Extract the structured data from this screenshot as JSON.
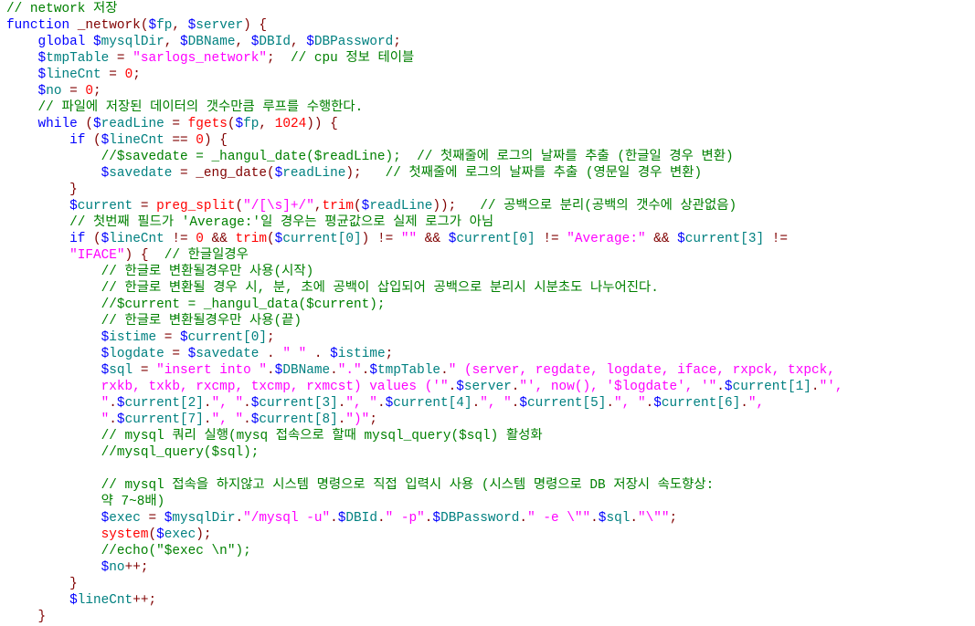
{
  "editor": {
    "language": "php",
    "colors": {
      "keyword": "#0000ff",
      "variable_sigil": "#0000ff",
      "variable_name": "#008080",
      "string": "#ff00ff",
      "comment": "#008000",
      "function": "#ff0000",
      "number": "#ff0000",
      "operator": "#800000",
      "background": "#ffffff"
    },
    "lines": [
      [
        {
          "t": "cm",
          "v": "// network 저장"
        }
      ],
      [
        {
          "t": "kw",
          "v": "function"
        },
        {
          "t": "op",
          "v": " _network("
        },
        {
          "t": "dl",
          "v": "$"
        },
        {
          "t": "vn",
          "v": "fp"
        },
        {
          "t": "op",
          "v": ", "
        },
        {
          "t": "dl",
          "v": "$"
        },
        {
          "t": "vn",
          "v": "server"
        },
        {
          "t": "op",
          "v": ") {"
        }
      ],
      [
        {
          "t": "op",
          "v": "    "
        },
        {
          "t": "kw",
          "v": "global"
        },
        {
          "t": "op",
          "v": " "
        },
        {
          "t": "dl",
          "v": "$"
        },
        {
          "t": "vn",
          "v": "mysqlDir"
        },
        {
          "t": "op",
          "v": ", "
        },
        {
          "t": "dl",
          "v": "$"
        },
        {
          "t": "vn",
          "v": "DBName"
        },
        {
          "t": "op",
          "v": ", "
        },
        {
          "t": "dl",
          "v": "$"
        },
        {
          "t": "vn",
          "v": "DBId"
        },
        {
          "t": "op",
          "v": ", "
        },
        {
          "t": "dl",
          "v": "$"
        },
        {
          "t": "vn",
          "v": "DBPassword"
        },
        {
          "t": "op",
          "v": ";"
        }
      ],
      [
        {
          "t": "op",
          "v": "    "
        },
        {
          "t": "dl",
          "v": "$"
        },
        {
          "t": "vn",
          "v": "tmpTable"
        },
        {
          "t": "op",
          "v": " = "
        },
        {
          "t": "st",
          "v": "\"sarlogs_network\""
        },
        {
          "t": "op",
          "v": ";  "
        },
        {
          "t": "cm",
          "v": "// cpu 정보 테이블"
        }
      ],
      [
        {
          "t": "op",
          "v": "    "
        },
        {
          "t": "dl",
          "v": "$"
        },
        {
          "t": "vn",
          "v": "lineCnt"
        },
        {
          "t": "op",
          "v": " = "
        },
        {
          "t": "nm",
          "v": "0"
        },
        {
          "t": "op",
          "v": ";"
        }
      ],
      [
        {
          "t": "op",
          "v": "    "
        },
        {
          "t": "dl",
          "v": "$"
        },
        {
          "t": "vn",
          "v": "no"
        },
        {
          "t": "op",
          "v": " = "
        },
        {
          "t": "nm",
          "v": "0"
        },
        {
          "t": "op",
          "v": ";"
        }
      ],
      [
        {
          "t": "op",
          "v": "    "
        },
        {
          "t": "cm",
          "v": "// 파일에 저장된 데이터의 갯수만큼 루프를 수행한다."
        }
      ],
      [
        {
          "t": "op",
          "v": "    "
        },
        {
          "t": "kw",
          "v": "while"
        },
        {
          "t": "op",
          "v": " ("
        },
        {
          "t": "dl",
          "v": "$"
        },
        {
          "t": "vn",
          "v": "readLine"
        },
        {
          "t": "op",
          "v": " = "
        },
        {
          "t": "fn",
          "v": "fgets"
        },
        {
          "t": "op",
          "v": "("
        },
        {
          "t": "dl",
          "v": "$"
        },
        {
          "t": "vn",
          "v": "fp"
        },
        {
          "t": "op",
          "v": ", "
        },
        {
          "t": "nm",
          "v": "1024"
        },
        {
          "t": "op",
          "v": ")) {"
        }
      ],
      [
        {
          "t": "op",
          "v": "        "
        },
        {
          "t": "kw",
          "v": "if"
        },
        {
          "t": "op",
          "v": " ("
        },
        {
          "t": "dl",
          "v": "$"
        },
        {
          "t": "vn",
          "v": "lineCnt"
        },
        {
          "t": "op",
          "v": " == "
        },
        {
          "t": "nm",
          "v": "0"
        },
        {
          "t": "op",
          "v": ") {"
        }
      ],
      [
        {
          "t": "op",
          "v": "            "
        },
        {
          "t": "cm",
          "v": "//$savedate = _hangul_date($readLine);  // 첫째줄에 로그의 날짜를 추출 (한글일 경우 변환)"
        }
      ],
      [
        {
          "t": "op",
          "v": "            "
        },
        {
          "t": "dl",
          "v": "$"
        },
        {
          "t": "vn",
          "v": "savedate"
        },
        {
          "t": "op",
          "v": " = _eng_date("
        },
        {
          "t": "dl",
          "v": "$"
        },
        {
          "t": "vn",
          "v": "readLine"
        },
        {
          "t": "op",
          "v": ");   "
        },
        {
          "t": "cm",
          "v": "// 첫째줄에 로그의 날짜를 추출 (영문일 경우 변환)"
        }
      ],
      [
        {
          "t": "op",
          "v": "        }"
        }
      ],
      [
        {
          "t": "op",
          "v": "        "
        },
        {
          "t": "dl",
          "v": "$"
        },
        {
          "t": "vn",
          "v": "current"
        },
        {
          "t": "op",
          "v": " = "
        },
        {
          "t": "fn",
          "v": "preg_split"
        },
        {
          "t": "op",
          "v": "("
        },
        {
          "t": "st",
          "v": "\"/[\\s]+/\""
        },
        {
          "t": "op",
          "v": ","
        },
        {
          "t": "fn",
          "v": "trim"
        },
        {
          "t": "op",
          "v": "("
        },
        {
          "t": "dl",
          "v": "$"
        },
        {
          "t": "vn",
          "v": "readLine"
        },
        {
          "t": "op",
          "v": "));   "
        },
        {
          "t": "cm",
          "v": "// 공백으로 분리(공백의 갯수에 상관없음)"
        }
      ],
      [
        {
          "t": "op",
          "v": "        "
        },
        {
          "t": "cm",
          "v": "// 첫번째 필드가 'Average:'일 경우는 평균값으로 실제 로그가 아님"
        }
      ],
      [
        {
          "t": "op",
          "v": "        "
        },
        {
          "t": "kw",
          "v": "if"
        },
        {
          "t": "op",
          "v": " ("
        },
        {
          "t": "dl",
          "v": "$"
        },
        {
          "t": "vn",
          "v": "lineCnt"
        },
        {
          "t": "op",
          "v": " != "
        },
        {
          "t": "nm",
          "v": "0"
        },
        {
          "t": "op",
          "v": " && "
        },
        {
          "t": "fn",
          "v": "trim"
        },
        {
          "t": "op",
          "v": "("
        },
        {
          "t": "dl",
          "v": "$"
        },
        {
          "t": "vn",
          "v": "current[0]"
        },
        {
          "t": "op",
          "v": ") != "
        },
        {
          "t": "st",
          "v": "\"\""
        },
        {
          "t": "op",
          "v": " && "
        },
        {
          "t": "dl",
          "v": "$"
        },
        {
          "t": "vn",
          "v": "current[0]"
        },
        {
          "t": "op",
          "v": " != "
        },
        {
          "t": "st",
          "v": "\"Average:\""
        },
        {
          "t": "op",
          "v": " && "
        },
        {
          "t": "dl",
          "v": "$"
        },
        {
          "t": "vn",
          "v": "current[3]"
        },
        {
          "t": "op",
          "v": " !="
        }
      ],
      [
        {
          "t": "op",
          "v": "        "
        },
        {
          "t": "st",
          "v": "\"IFACE\""
        },
        {
          "t": "op",
          "v": ") {  "
        },
        {
          "t": "cm",
          "v": "// 한글일경우"
        }
      ],
      [
        {
          "t": "op",
          "v": "            "
        },
        {
          "t": "cm",
          "v": "// 한글로 변환될경우만 사용(시작)"
        }
      ],
      [
        {
          "t": "op",
          "v": "            "
        },
        {
          "t": "cm",
          "v": "// 한글로 변환될 경우 시, 분, 초에 공백이 삽입되어 공백으로 분리시 시분초도 나누어진다."
        }
      ],
      [
        {
          "t": "op",
          "v": "            "
        },
        {
          "t": "cm",
          "v": "//$current = _hangul_data($current);"
        }
      ],
      [
        {
          "t": "op",
          "v": "            "
        },
        {
          "t": "cm",
          "v": "// 한글로 변환될경우만 사용(끝)"
        }
      ],
      [
        {
          "t": "op",
          "v": "            "
        },
        {
          "t": "dl",
          "v": "$"
        },
        {
          "t": "vn",
          "v": "istime"
        },
        {
          "t": "op",
          "v": " = "
        },
        {
          "t": "dl",
          "v": "$"
        },
        {
          "t": "vn",
          "v": "current[0]"
        },
        {
          "t": "op",
          "v": ";"
        }
      ],
      [
        {
          "t": "op",
          "v": "            "
        },
        {
          "t": "dl",
          "v": "$"
        },
        {
          "t": "vn",
          "v": "logdate"
        },
        {
          "t": "op",
          "v": " = "
        },
        {
          "t": "dl",
          "v": "$"
        },
        {
          "t": "vn",
          "v": "savedate"
        },
        {
          "t": "op",
          "v": " . "
        },
        {
          "t": "st",
          "v": "\" \""
        },
        {
          "t": "op",
          "v": " . "
        },
        {
          "t": "dl",
          "v": "$"
        },
        {
          "t": "vn",
          "v": "istime"
        },
        {
          "t": "op",
          "v": ";"
        }
      ],
      [
        {
          "t": "op",
          "v": "            "
        },
        {
          "t": "dl",
          "v": "$"
        },
        {
          "t": "vn",
          "v": "sql"
        },
        {
          "t": "op",
          "v": " = "
        },
        {
          "t": "st",
          "v": "\"insert into \""
        },
        {
          "t": "op",
          "v": "."
        },
        {
          "t": "dl",
          "v": "$"
        },
        {
          "t": "vn",
          "v": "DBName"
        },
        {
          "t": "op",
          "v": "."
        },
        {
          "t": "st",
          "v": "\".\""
        },
        {
          "t": "op",
          "v": "."
        },
        {
          "t": "dl",
          "v": "$"
        },
        {
          "t": "vn",
          "v": "tmpTable"
        },
        {
          "t": "op",
          "v": "."
        },
        {
          "t": "st",
          "v": "\" (server, regdate, logdate, iface, rxpck, txpck,"
        }
      ],
      [
        {
          "t": "op",
          "v": "            "
        },
        {
          "t": "st",
          "v": "rxkb, txkb, rxcmp, txcmp, rxmcst) values ('\""
        },
        {
          "t": "op",
          "v": "."
        },
        {
          "t": "dl",
          "v": "$"
        },
        {
          "t": "vn",
          "v": "server"
        },
        {
          "t": "op",
          "v": "."
        },
        {
          "t": "st",
          "v": "\"', now(), '$logdate', '\""
        },
        {
          "t": "op",
          "v": "."
        },
        {
          "t": "dl",
          "v": "$"
        },
        {
          "t": "vn",
          "v": "current[1]"
        },
        {
          "t": "op",
          "v": "."
        },
        {
          "t": "st",
          "v": "\"',"
        }
      ],
      [
        {
          "t": "op",
          "v": "            "
        },
        {
          "t": "st",
          "v": "\""
        },
        {
          "t": "op",
          "v": "."
        },
        {
          "t": "dl",
          "v": "$"
        },
        {
          "t": "vn",
          "v": "current[2]"
        },
        {
          "t": "op",
          "v": "."
        },
        {
          "t": "st",
          "v": "\", \""
        },
        {
          "t": "op",
          "v": "."
        },
        {
          "t": "dl",
          "v": "$"
        },
        {
          "t": "vn",
          "v": "current[3]"
        },
        {
          "t": "op",
          "v": "."
        },
        {
          "t": "st",
          "v": "\", \""
        },
        {
          "t": "op",
          "v": "."
        },
        {
          "t": "dl",
          "v": "$"
        },
        {
          "t": "vn",
          "v": "current[4]"
        },
        {
          "t": "op",
          "v": "."
        },
        {
          "t": "st",
          "v": "\", \""
        },
        {
          "t": "op",
          "v": "."
        },
        {
          "t": "dl",
          "v": "$"
        },
        {
          "t": "vn",
          "v": "current[5]"
        },
        {
          "t": "op",
          "v": "."
        },
        {
          "t": "st",
          "v": "\", \""
        },
        {
          "t": "op",
          "v": "."
        },
        {
          "t": "dl",
          "v": "$"
        },
        {
          "t": "vn",
          "v": "current[6]"
        },
        {
          "t": "op",
          "v": "."
        },
        {
          "t": "st",
          "v": "\","
        }
      ],
      [
        {
          "t": "op",
          "v": "            "
        },
        {
          "t": "st",
          "v": "\""
        },
        {
          "t": "op",
          "v": "."
        },
        {
          "t": "dl",
          "v": "$"
        },
        {
          "t": "vn",
          "v": "current[7]"
        },
        {
          "t": "op",
          "v": "."
        },
        {
          "t": "st",
          "v": "\", \""
        },
        {
          "t": "op",
          "v": "."
        },
        {
          "t": "dl",
          "v": "$"
        },
        {
          "t": "vn",
          "v": "current[8]"
        },
        {
          "t": "op",
          "v": "."
        },
        {
          "t": "st",
          "v": "\")\""
        },
        {
          "t": "op",
          "v": ";"
        }
      ],
      [
        {
          "t": "op",
          "v": "            "
        },
        {
          "t": "cm",
          "v": "// mysql 쿼리 실행(mysq 접속으로 할때 mysql_query($sql) 활성화"
        }
      ],
      [
        {
          "t": "op",
          "v": "            "
        },
        {
          "t": "cm",
          "v": "//mysql_query($sql);"
        }
      ],
      [
        {
          "t": "op",
          "v": ""
        }
      ],
      [
        {
          "t": "op",
          "v": "            "
        },
        {
          "t": "cm",
          "v": "// mysql 접속을 하지않고 시스템 명령으로 직접 입력시 사용 (시스템 명령으로 DB 저장시 속도향상:"
        }
      ],
      [
        {
          "t": "op",
          "v": "            "
        },
        {
          "t": "cm",
          "v": "약 7~8배)"
        }
      ],
      [
        {
          "t": "op",
          "v": "            "
        },
        {
          "t": "dl",
          "v": "$"
        },
        {
          "t": "vn",
          "v": "exec"
        },
        {
          "t": "op",
          "v": " = "
        },
        {
          "t": "dl",
          "v": "$"
        },
        {
          "t": "vn",
          "v": "mysqlDir"
        },
        {
          "t": "op",
          "v": "."
        },
        {
          "t": "st",
          "v": "\"/mysql -u\""
        },
        {
          "t": "op",
          "v": "."
        },
        {
          "t": "dl",
          "v": "$"
        },
        {
          "t": "vn",
          "v": "DBId"
        },
        {
          "t": "op",
          "v": "."
        },
        {
          "t": "st",
          "v": "\" -p\""
        },
        {
          "t": "op",
          "v": "."
        },
        {
          "t": "dl",
          "v": "$"
        },
        {
          "t": "vn",
          "v": "DBPassword"
        },
        {
          "t": "op",
          "v": "."
        },
        {
          "t": "st",
          "v": "\" -e \\\"\""
        },
        {
          "t": "op",
          "v": "."
        },
        {
          "t": "dl",
          "v": "$"
        },
        {
          "t": "vn",
          "v": "sql"
        },
        {
          "t": "op",
          "v": "."
        },
        {
          "t": "st",
          "v": "\"\\\"\""
        },
        {
          "t": "op",
          "v": ";"
        }
      ],
      [
        {
          "t": "op",
          "v": "            "
        },
        {
          "t": "fn",
          "v": "system"
        },
        {
          "t": "op",
          "v": "("
        },
        {
          "t": "dl",
          "v": "$"
        },
        {
          "t": "vn",
          "v": "exec"
        },
        {
          "t": "op",
          "v": ");"
        }
      ],
      [
        {
          "t": "op",
          "v": "            "
        },
        {
          "t": "cm",
          "v": "//echo(\"$exec \\n\");"
        }
      ],
      [
        {
          "t": "op",
          "v": "            "
        },
        {
          "t": "dl",
          "v": "$"
        },
        {
          "t": "vn",
          "v": "no"
        },
        {
          "t": "op",
          "v": "++;"
        }
      ],
      [
        {
          "t": "op",
          "v": "        }"
        }
      ],
      [
        {
          "t": "op",
          "v": "        "
        },
        {
          "t": "dl",
          "v": "$"
        },
        {
          "t": "vn",
          "v": "lineCnt"
        },
        {
          "t": "op",
          "v": "++;"
        }
      ],
      [
        {
          "t": "op",
          "v": "    }"
        }
      ]
    ]
  }
}
